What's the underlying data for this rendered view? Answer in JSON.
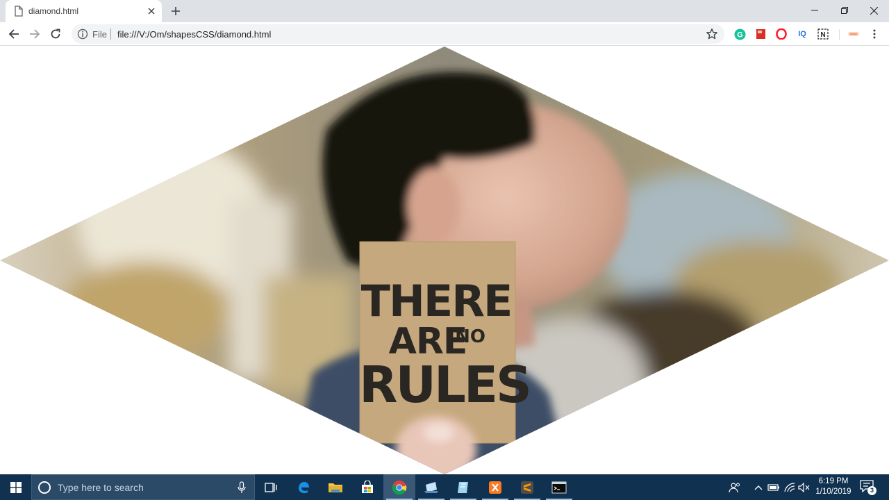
{
  "browser": {
    "tab": {
      "title": "diamond.html"
    },
    "address_bar": {
      "scheme_label": "File",
      "url": "file:///V:/Om/shapesCSS/diamond.html"
    },
    "extensions": [
      {
        "name": "grammarly-icon",
        "color": "#15c39a",
        "glyph": "G"
      },
      {
        "name": "red-book-icon",
        "color": "#d93025"
      },
      {
        "name": "opera-icon",
        "color": "#ff1b2d"
      },
      {
        "name": "iq-icon",
        "color": "#1a73e8",
        "glyph": "IQ"
      },
      {
        "name": "notion-n-icon",
        "color": "#202124",
        "glyph": "N"
      },
      {
        "name": "toggle-icon",
        "color": "#f28b50"
      }
    ]
  },
  "page": {
    "image_caption_lines": [
      "THERE",
      "ARE",
      "NO",
      "RULES"
    ]
  },
  "taskbar": {
    "search_placeholder": "Type here to search",
    "clock_time": "6:19 PM",
    "clock_date": "1/10/2019",
    "notification_count": "3",
    "apps": [
      "task-view",
      "edge",
      "file-explorer",
      "store",
      "chrome",
      "app-6",
      "app-7",
      "xampp",
      "sublime-text",
      "terminal"
    ]
  },
  "colors": {
    "taskbar": "#10314f",
    "tab_strip": "#dee1e6",
    "card": "#c6a87e"
  }
}
